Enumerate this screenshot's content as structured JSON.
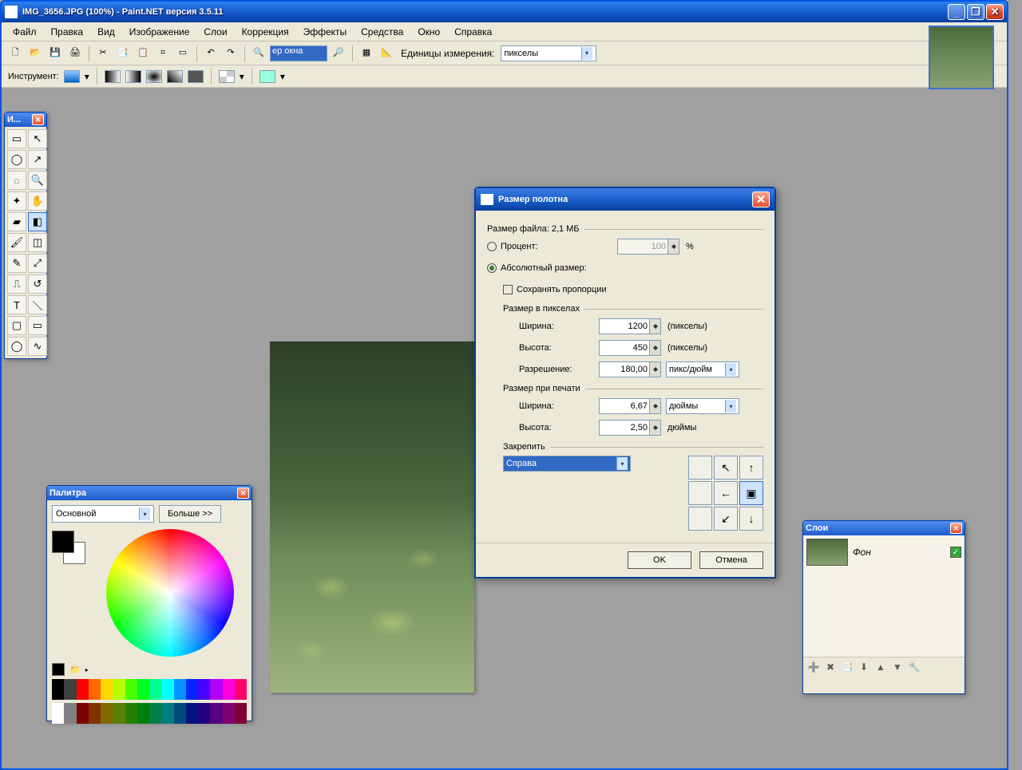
{
  "window": {
    "title": "IMG_3656.JPG (100%) - Paint.NET версия 3.5.11"
  },
  "menus": [
    "Файл",
    "Правка",
    "Вид",
    "Изображение",
    "Слои",
    "Коррекция",
    "Эффекты",
    "Средства",
    "Окно",
    "Справка"
  ],
  "toolbar": {
    "zoom_value": "ер окна",
    "units_label": "Единицы измерения:",
    "unit_selected": "пикселы"
  },
  "tooloptions": {
    "label": "Инструмент:"
  },
  "toolspanel": {
    "title": "И..."
  },
  "palette": {
    "title": "Палитра",
    "mode": "Основной",
    "more_btn": "Больше >>"
  },
  "layers": {
    "title": "Слои",
    "items": [
      {
        "name": "Фон",
        "visible": true
      }
    ]
  },
  "dialog": {
    "title": "Размер полотна",
    "file_size_label": "Размер файла: 2,1 МБ",
    "percent_label": "Процент:",
    "percent_value": "100",
    "percent_unit": "%",
    "absolute_label": "Абсолютный размер:",
    "keep_aspect": "Сохранять пропорции",
    "px_group": "Размер в пикселах",
    "width_label": "Ширина:",
    "height_label": "Высота:",
    "width_px": "1200",
    "height_px": "450",
    "px_unit": "(пикселы)",
    "resolution_label": "Разрешение:",
    "resolution": "180,00",
    "res_unit": "пикс/дюйм",
    "print_group": "Размер при печати",
    "width_print": "6,67",
    "height_print": "2,50",
    "print_unit": "дюймы",
    "anchor_group": "Закрепить",
    "anchor_value": "Справа",
    "ok": "OK",
    "cancel": "Отмена"
  }
}
